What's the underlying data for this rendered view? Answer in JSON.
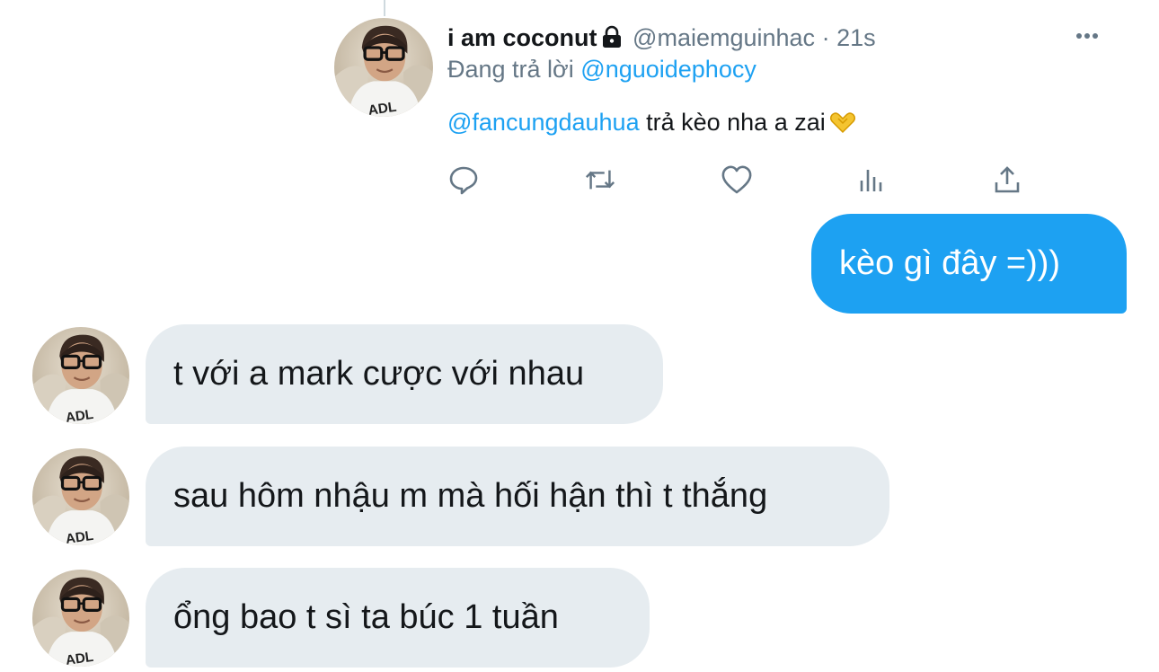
{
  "tweet": {
    "display_name": "i am coconut",
    "handle": "@maiemguinhac",
    "separator": "·",
    "time": "21s",
    "reply_prefix": "Đang trả lời",
    "reply_to": "@nguoidephocy",
    "mention": "@fancungdauhua",
    "text": "trả kèo nha a zai",
    "icons": {
      "more": "more-horizontal-icon",
      "lock": "lock-icon",
      "reply": "reply-icon",
      "retweet": "retweet-icon",
      "like": "heart-icon",
      "analytics": "analytics-icon",
      "share": "share-icon"
    }
  },
  "chat": {
    "sent": [
      {
        "text": "kèo gì đây =)))"
      }
    ],
    "received": [
      {
        "text": "t với a mark cược với nhau"
      },
      {
        "text": "sau hôm nhậu m mà hối hận thì t thắng"
      },
      {
        "text": "ổng bao t sì ta búc 1 tuần"
      }
    ]
  },
  "colors": {
    "accent": "#1da1f2",
    "secondary_text": "#657786",
    "received_bubble": "#e6ecf0",
    "sent_bubble": "#1da1f2"
  }
}
